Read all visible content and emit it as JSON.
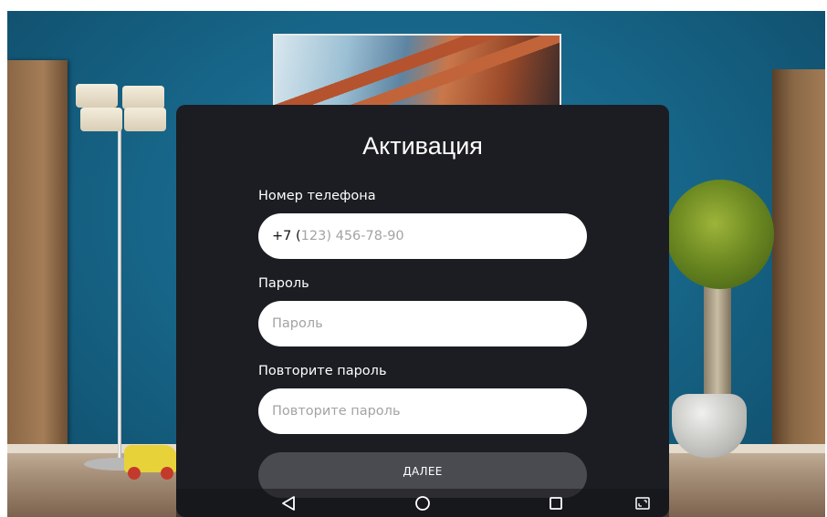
{
  "dialog": {
    "title": "Активация",
    "phone": {
      "label": "Номер телефона",
      "prefix": "+7 (",
      "mask": "123) 456-78-90"
    },
    "password": {
      "label": "Пароль",
      "placeholder": "Пароль"
    },
    "repeat_password": {
      "label": "Повторите пароль",
      "placeholder": "Повторите пароль"
    },
    "next_label": "ДАЛЕЕ"
  },
  "nav_bar": {
    "icons": [
      "back-triangle-icon",
      "home-circle-icon",
      "recents-square-icon",
      "screenshot-icon"
    ]
  },
  "colors": {
    "dialog_bg": "#1c1d22",
    "field_bg": "#ffffff",
    "button_bg": "#4a4b50",
    "placeholder": "#a3a3a3"
  }
}
